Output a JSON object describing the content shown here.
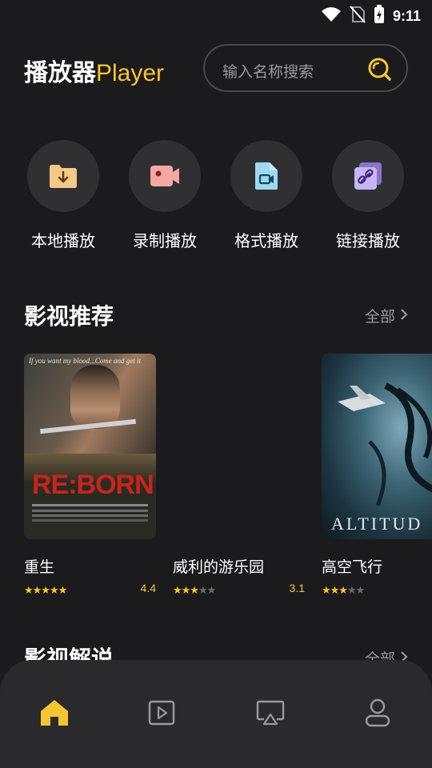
{
  "status": {
    "time": "9:11"
  },
  "header": {
    "title_cn": "播放器",
    "title_en": "Player"
  },
  "search": {
    "placeholder": "输入名称搜索"
  },
  "quick_actions": [
    {
      "label": "本地播放",
      "icon": "download-folder-icon"
    },
    {
      "label": "录制播放",
      "icon": "video-camera-icon"
    },
    {
      "label": "格式播放",
      "icon": "format-file-icon"
    },
    {
      "label": "链接播放",
      "icon": "link-icon"
    }
  ],
  "recommend": {
    "title": "影视推荐",
    "more": "全部",
    "movies": [
      {
        "title": "重生",
        "score": "4.4",
        "stars": 5,
        "poster_text": "RE:BORN",
        "tagline": "If you want my blood...Come and get it"
      },
      {
        "title": "威利的游乐园",
        "score": "3.1",
        "stars": 3
      },
      {
        "title": "高空飞行",
        "score": "",
        "stars": 3,
        "poster_text": "ALTITUD"
      }
    ]
  },
  "commentary": {
    "title": "影视解说",
    "more": "全部"
  },
  "tabs": [
    {
      "name": "home",
      "icon": "home-icon",
      "active": true
    },
    {
      "name": "player",
      "icon": "play-square-icon",
      "active": false
    },
    {
      "name": "cast",
      "icon": "screen-cast-icon",
      "active": false
    },
    {
      "name": "profile",
      "icon": "user-icon",
      "active": false
    }
  ],
  "colors": {
    "accent": "#f7c531",
    "background": "#1b1b1d",
    "surface": "#303033"
  }
}
